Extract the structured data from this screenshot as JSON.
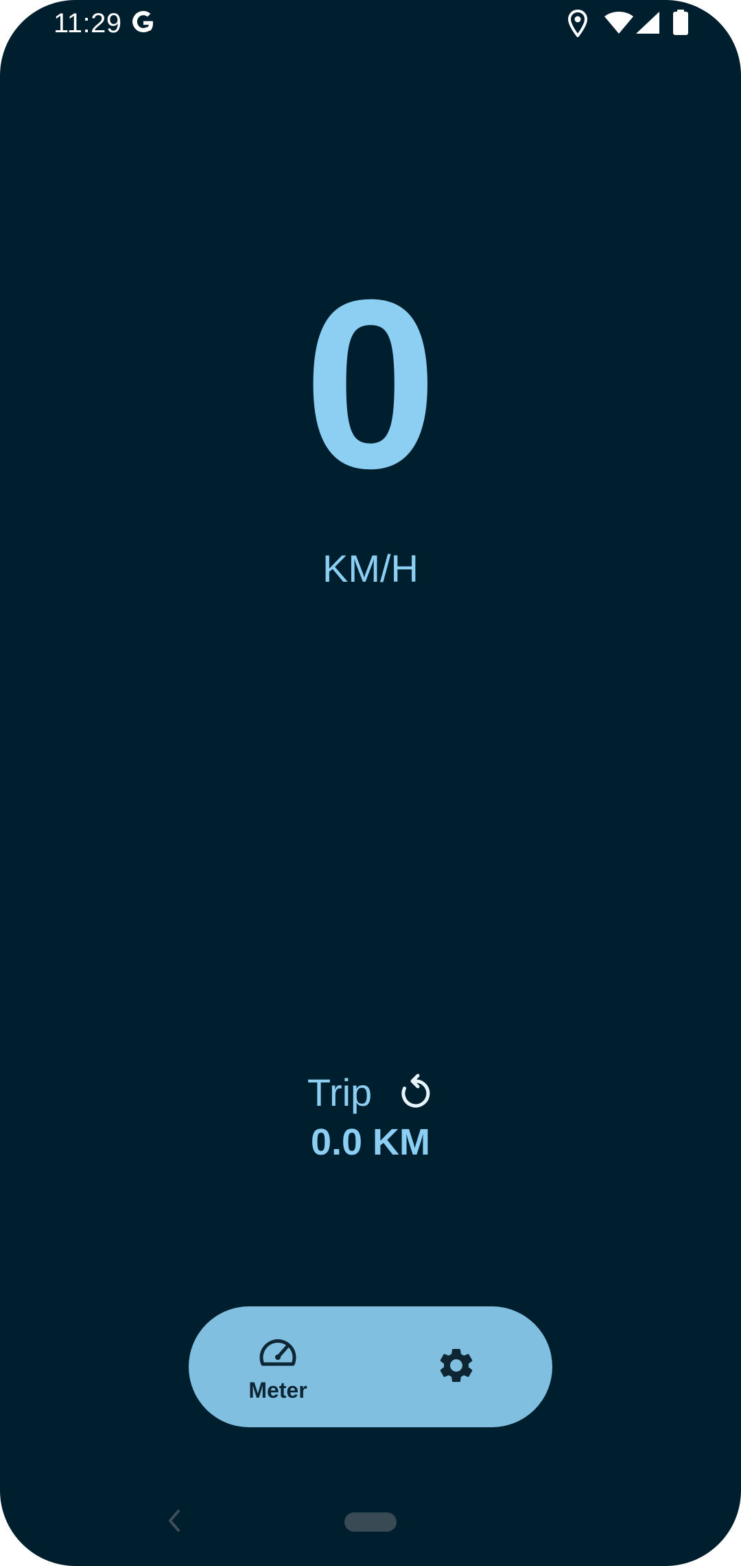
{
  "status_bar": {
    "time": "11:29",
    "icons": [
      "google-g-icon",
      "location-icon",
      "wifi-icon",
      "signal-icon",
      "battery-icon"
    ]
  },
  "speedometer": {
    "speed": "0",
    "unit": "KM/H"
  },
  "trip": {
    "label": "Trip",
    "distance": "0.0 KM",
    "reset_icon": "reset-icon"
  },
  "bottom_nav": {
    "items": [
      {
        "label": "Meter",
        "icon": "speedometer-icon",
        "selected": true
      },
      {
        "label": "",
        "icon": "gear-icon",
        "selected": false
      }
    ]
  },
  "system_nav": {
    "icons": [
      "back-icon",
      "home-pill"
    ]
  },
  "colors": {
    "background": "#001f2e",
    "accent": "#8ccff3",
    "nav_pill": "#80bfe0",
    "nav_foreground": "#0e2533"
  }
}
